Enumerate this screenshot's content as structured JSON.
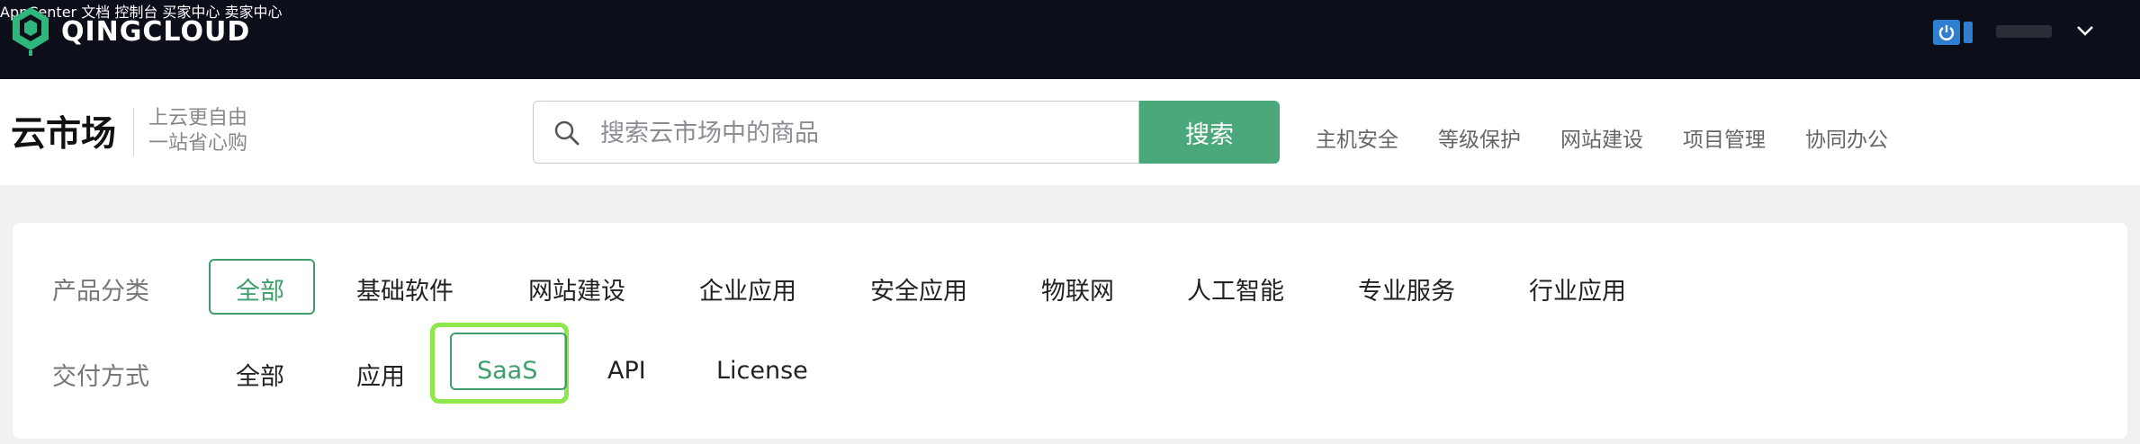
{
  "brand": {
    "name": "QINGCLOUD"
  },
  "topnav": {
    "items": [
      "AppCenter",
      "文档",
      "控制台",
      "买家中心",
      "卖家中心"
    ]
  },
  "subheader": {
    "title": "云市场",
    "slogan_line1": "上云更自由",
    "slogan_line2": "一站省心购",
    "search_placeholder": "搜索云市场中的商品",
    "search_button": "搜索",
    "hot_links": [
      "主机安全",
      "等级保护",
      "网站建设",
      "项目管理",
      "协同办公"
    ]
  },
  "filters": {
    "category_label": "产品分类",
    "categories": [
      "全部",
      "基础软件",
      "网站建设",
      "企业应用",
      "安全应用",
      "物联网",
      "人工智能",
      "专业服务",
      "行业应用"
    ],
    "selected_category": "全部",
    "delivery_label": "交付方式",
    "delivery": [
      "全部",
      "应用",
      "SaaS",
      "API",
      "License"
    ],
    "selected_delivery": "SaaS"
  },
  "colors": {
    "topbar_bg": "#0c0f19",
    "accent_green": "#4aa87a",
    "highlight": "#8fe84a"
  }
}
